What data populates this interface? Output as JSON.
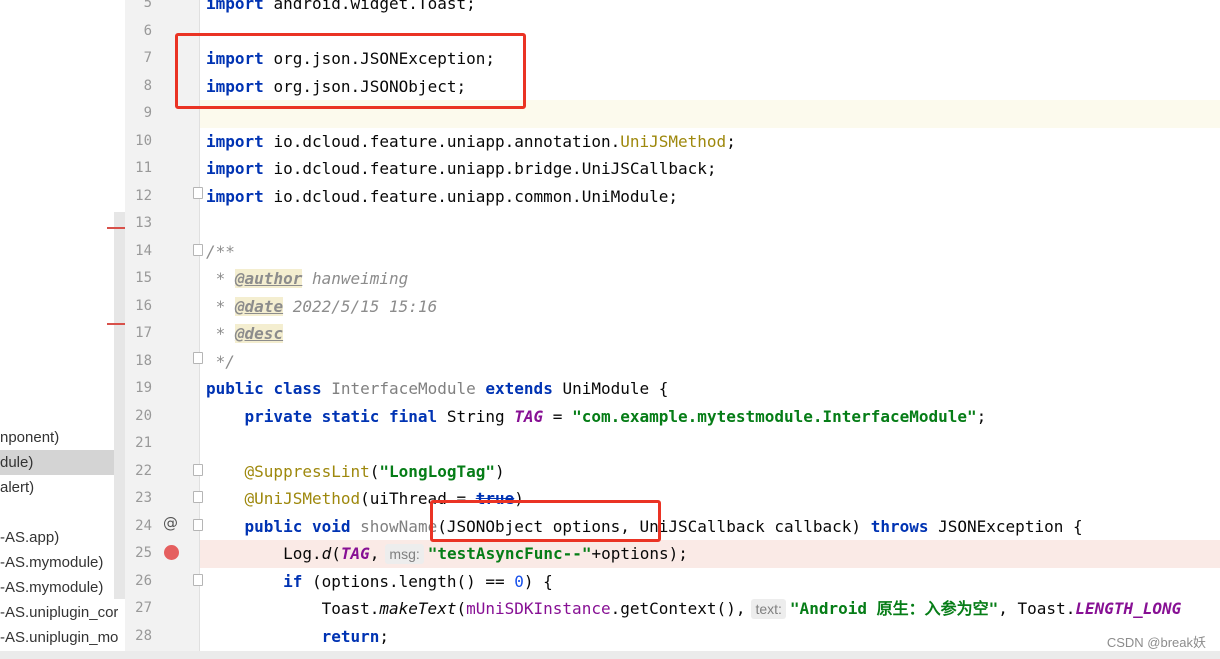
{
  "sidebar": {
    "items": [
      {
        "label": "nponent)",
        "selected": false
      },
      {
        "label": "dule)",
        "selected": true
      },
      {
        "label": "alert)",
        "selected": false
      },
      {
        "label": "-AS.app)",
        "selected": false
      },
      {
        "label": "-AS.mymodule)",
        "selected": false
      },
      {
        "label": "-AS.mymodule)",
        "selected": false
      },
      {
        "label": "-AS.uniplugin_cor",
        "selected": false
      },
      {
        "label": "-AS.uniplugin_mo",
        "selected": false
      }
    ]
  },
  "gutter": {
    "line_numbers": [
      "5",
      "6",
      "7",
      "8",
      "9",
      "10",
      "11",
      "12",
      "13",
      "14",
      "15",
      "16",
      "17",
      "18",
      "19",
      "20",
      "21",
      "22",
      "23",
      "24",
      "25",
      "26",
      "27",
      "28"
    ],
    "override_icon": "@"
  },
  "code": {
    "l5": {
      "kw": "import",
      "rest": "android.widget.Toast;"
    },
    "l7": {
      "kw": "import",
      "rest": "org.json.JSONException;"
    },
    "l8": {
      "kw": "import",
      "rest": "org.json.JSONObject;"
    },
    "l10": {
      "kw": "import",
      "pre": "io.dcloud.feature.uniapp.annotation.",
      "ann": "UniJSMethod",
      "post": ";"
    },
    "l11": {
      "kw": "import",
      "rest": "io.dcloud.feature.uniapp.bridge.UniJSCallback;"
    },
    "l12": {
      "kw": "import",
      "rest": "io.dcloud.feature.uniapp.common.UniModule;"
    },
    "l14": {
      "text": "/**"
    },
    "l15": {
      "star": " * ",
      "tag": "@author",
      "val": " hanweiming"
    },
    "l16": {
      "star": " * ",
      "tag": "@date",
      "val": " 2022/5/15 15:16"
    },
    "l17": {
      "star": " * ",
      "tag": "@desc"
    },
    "l18": {
      "text": " */"
    },
    "l19": {
      "kw1": "public",
      "kw2": "class",
      "name": "InterfaceModule",
      "kw3": "extends",
      "rest": "UniModule {"
    },
    "l20": {
      "kw": "private static final",
      "type": "String",
      "const": "TAG",
      "eq": " = ",
      "str": "\"com.example.mytestmodule.InterfaceModule\"",
      "end": ";"
    },
    "l22": {
      "ann": "@SuppressLint",
      "open": "(",
      "str": "\"LongLogTag\"",
      "close": ")"
    },
    "l23": {
      "ann": "@UniJSMethod",
      "open": "(uiThread = ",
      "val": "true",
      "close": ")"
    },
    "l24": {
      "kw": "public void",
      "name": "showName",
      "params": "(JSONObject options, UniJSCallback callback) ",
      "kw2": "throws",
      "rest": " JSONException {"
    },
    "l25": {
      "pre": "Log.",
      "method": "d",
      "open": "(",
      "const": "TAG",
      "comma": ",",
      "hint": "msg:",
      "str": "\"testAsyncFunc--\"",
      "rest": "+options);"
    },
    "l26": {
      "kw": "if",
      "pre": " (options.length() == ",
      "num": "0",
      "post": ") {"
    },
    "l27": {
      "pre": "Toast.",
      "method": "makeText",
      "open": "(",
      "field": "mUniSDKInstance",
      "mid": ".getContext(),",
      "hint": "text:",
      "str": "\"Android 原生：入参为空\"",
      "post": ", Toast.",
      "const": "LENGTH_LONG"
    },
    "l28": {
      "kw": "return",
      "end": ";"
    }
  },
  "watermark": "CSDN @break妖",
  "colors": {
    "keyword": "#0033b3",
    "string": "#067d17",
    "annotation": "#9e880d",
    "comment": "#8c8c8c",
    "constant": "#871094",
    "highlight_box": "#ea3324",
    "breakpoint": "#e55f5f",
    "caret_row": "#fcfaed",
    "breakpoint_row": "#faeae6"
  }
}
